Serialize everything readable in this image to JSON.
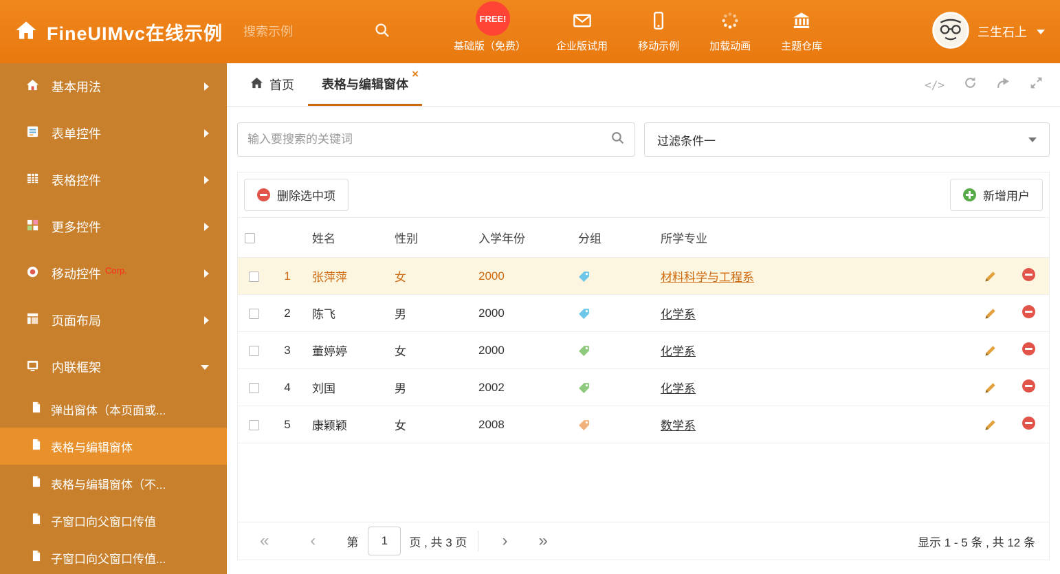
{
  "header": {
    "title": "FineUIMvc在线示例",
    "search_placeholder": "搜索示例",
    "free_badge": "FREE!",
    "nav": [
      {
        "label": "基础版（免费）",
        "icon": "download-icon"
      },
      {
        "label": "企业版试用",
        "icon": "envelope-icon"
      },
      {
        "label": "移动示例",
        "icon": "mobile-icon"
      },
      {
        "label": "加载动画",
        "icon": "spinner-icon"
      },
      {
        "label": "主题仓库",
        "icon": "bank-icon"
      }
    ],
    "username": "三生石上"
  },
  "sidebar": {
    "items": [
      {
        "label": "基本用法"
      },
      {
        "label": "表单控件"
      },
      {
        "label": "表格控件"
      },
      {
        "label": "更多控件"
      },
      {
        "label": "移动控件",
        "badge": "Corp."
      },
      {
        "label": "页面布局"
      },
      {
        "label": "内联框架"
      }
    ],
    "subitems": [
      {
        "label": "弹出窗体（本页面或..."
      },
      {
        "label": "表格与编辑窗体"
      },
      {
        "label": "表格与编辑窗体（不..."
      },
      {
        "label": "子窗口向父窗口传值"
      },
      {
        "label": "子窗口向父窗口传值..."
      }
    ]
  },
  "tabs": {
    "home_label": "首页",
    "active_label": "表格与编辑窗体"
  },
  "icons": {
    "code_glyph": "</>"
  },
  "filters": {
    "search_placeholder": "输入要搜索的关键词",
    "filter_value": "过滤条件一"
  },
  "toolbar": {
    "delete_label": "删除选中项",
    "add_label": "新增用户"
  },
  "table": {
    "headers": {
      "name": "姓名",
      "gender": "性别",
      "year": "入学年份",
      "group": "分组",
      "major": "所学专业"
    },
    "rows": [
      {
        "num": "1",
        "name": "张萍萍",
        "gender": "女",
        "year": "2000",
        "tag_color": "#6ec6e8",
        "major": "材料科学与工程系"
      },
      {
        "num": "2",
        "name": "陈飞",
        "gender": "男",
        "year": "2000",
        "tag_color": "#6ec6e8",
        "major": "化学系"
      },
      {
        "num": "3",
        "name": "董婷婷",
        "gender": "女",
        "year": "2000",
        "tag_color": "#8fc97e",
        "major": "化学系"
      },
      {
        "num": "4",
        "name": "刘国",
        "gender": "男",
        "year": "2002",
        "tag_color": "#8fc97e",
        "major": "化学系"
      },
      {
        "num": "5",
        "name": "康颖颖",
        "gender": "女",
        "year": "2008",
        "tag_color": "#f0b27a",
        "major": "数学系"
      }
    ]
  },
  "pagination": {
    "page_label_before": "第",
    "page_value": "1",
    "page_label_after": "页 , 共 3 页",
    "summary": "显示 1 - 5 条 , 共 12 条"
  },
  "colors": {
    "header_bg": "#ee7d12",
    "sidebar_bg": "#c8802c",
    "sidebar_active_bg": "#e8912c",
    "accent": "#c9690f",
    "selected_row_bg": "#fcf5df",
    "free_badge_bg": "#ff4334",
    "corp_red": "#ff2a1c"
  }
}
